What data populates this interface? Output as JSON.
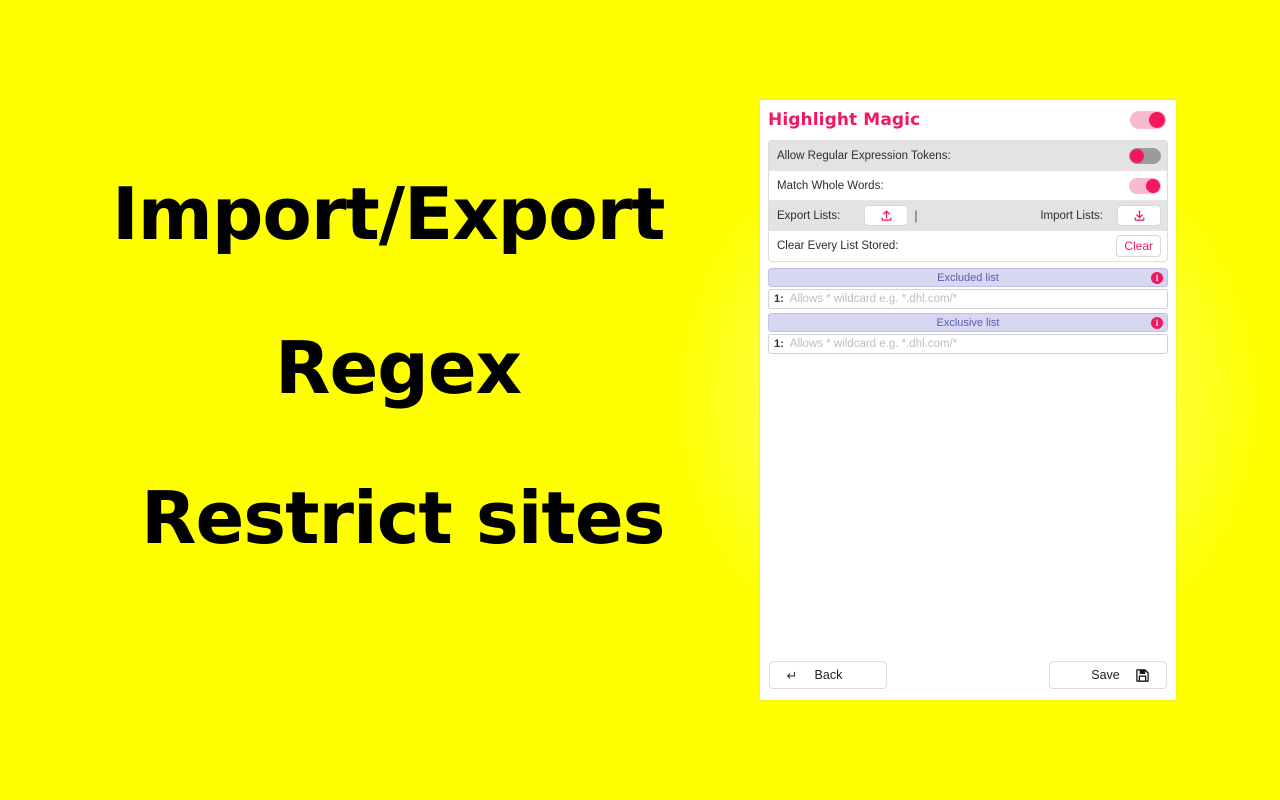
{
  "background": {
    "color": "#ffff00",
    "glow_color": "#ffffff"
  },
  "promo": {
    "lines": [
      "Import/Export",
      "Regex",
      "Restrict sites"
    ],
    "text_color": "#000000"
  },
  "popup": {
    "title": "Highlight Magic",
    "title_color": "#f4175e",
    "master_toggle": {
      "name": "master-enable-toggle",
      "state": "on"
    },
    "settings": [
      {
        "label": "Allow Regular Expression Tokens:",
        "control": "toggle",
        "state": "off",
        "shaded": true
      },
      {
        "label": "Match Whole Words:",
        "control": "toggle",
        "state": "on",
        "shaded": false
      },
      {
        "label": "Export Lists:",
        "control": "export-import",
        "export_icon": "upload-icon",
        "divider": "|",
        "label2": "Import Lists:",
        "import_icon": "download-icon",
        "shaded": true
      },
      {
        "label": "Clear Every List Stored:",
        "control": "button",
        "button_label": "Clear",
        "button_color": "#f4175e",
        "shaded": false
      }
    ],
    "lists": [
      {
        "title": "Excluded list",
        "info_icon": "i",
        "rows": [
          {
            "index": "1:",
            "placeholder": "Allows * wildcard e.g. *.dhl.com/*",
            "value": ""
          }
        ]
      },
      {
        "title": "Exclusive list",
        "info_icon": "i",
        "rows": [
          {
            "index": "1:",
            "placeholder": "Allows * wildcard e.g. *.dhl.com/*",
            "value": ""
          }
        ]
      }
    ],
    "footer": {
      "back_label": "Back",
      "back_glyph": "↵",
      "save_label": "Save",
      "save_glyph": "save-icon"
    },
    "accent_color": "#f4175e",
    "list_header_bg": "#d7d7f2",
    "list_header_text_color": "#5b5bb0"
  }
}
